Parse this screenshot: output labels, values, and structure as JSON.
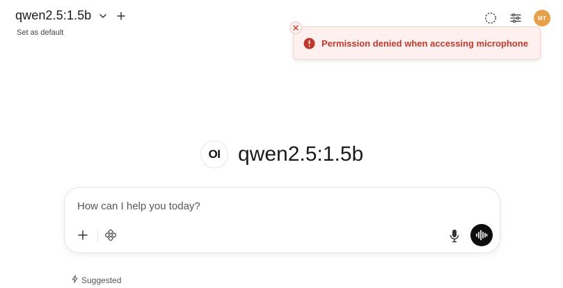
{
  "header": {
    "model_name": "qwen2.5:1.5b",
    "set_default": "Set as default",
    "avatar_initials": "MT",
    "icons": [
      "chevron-down-icon",
      "plus-icon",
      "temporary-chat-icon",
      "settings-sliders-icon"
    ]
  },
  "toast": {
    "message": "Permission denied when accessing microphone",
    "icon": "error-circle-icon"
  },
  "hero": {
    "logo_text": "OI",
    "title": "qwen2.5:1.5b"
  },
  "chat": {
    "placeholder": "How can I help you today?"
  },
  "suggested": {
    "label": "Suggested"
  },
  "colors": {
    "error": "#c0372c",
    "toast_bg": "#fdf0ef",
    "avatar_bg": "#e8a04a",
    "voice_button_bg": "#0d0d0d"
  }
}
